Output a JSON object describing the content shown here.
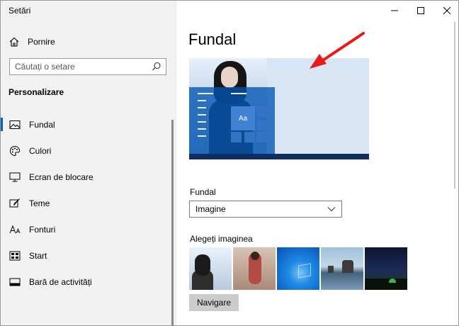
{
  "window": {
    "title": "Setări"
  },
  "sidebar": {
    "home_label": "Pornire",
    "search_placeholder": "Căutați o setare",
    "section_title": "Personalizare",
    "items": [
      {
        "label": "Fundal",
        "icon": "picture-icon",
        "active": true
      },
      {
        "label": "Culori",
        "icon": "palette-icon",
        "active": false
      },
      {
        "label": "Ecran de blocare",
        "icon": "monitor-icon",
        "active": false
      },
      {
        "label": "Teme",
        "icon": "brush-icon",
        "active": false
      },
      {
        "label": "Fonturi",
        "icon": "font-icon",
        "active": false
      },
      {
        "label": "Start",
        "icon": "start-icon",
        "active": false
      },
      {
        "label": "Bară de activități",
        "icon": "taskbar-icon",
        "active": false
      }
    ]
  },
  "main": {
    "title": "Fundal",
    "preview": {
      "tile_label": "Aa"
    },
    "background_label": "Fundal",
    "background_value": "Imagine",
    "choose_label": "Alegeți imaginea",
    "browse_button": "Navigare"
  },
  "colors": {
    "accent": "#0063b1",
    "arrow": "#e81b1b"
  }
}
